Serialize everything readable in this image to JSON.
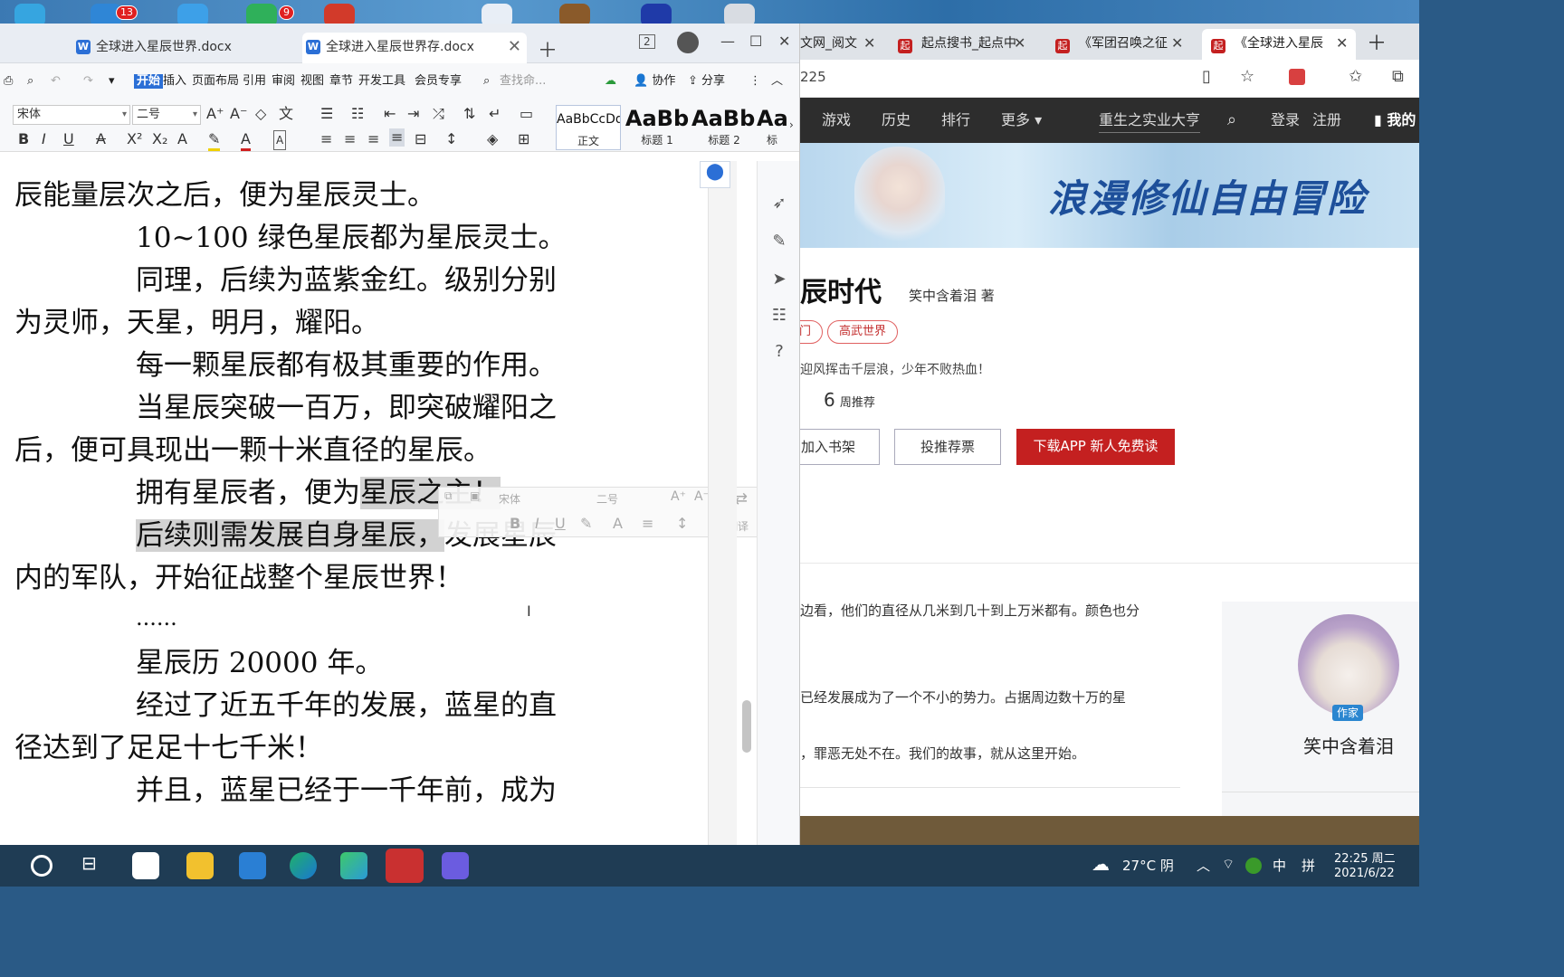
{
  "desktop": {
    "badges": [
      "13",
      "9"
    ]
  },
  "wps": {
    "tabs": [
      {
        "label": "全球进入星辰世界.docx"
      },
      {
        "label": "全球进入星辰世界存.docx"
      }
    ],
    "tab_count": "2",
    "menu": [
      "开始",
      "插入",
      "页面布局",
      "引用",
      "审阅",
      "视图",
      "章节",
      "开发工具",
      "会员专享"
    ],
    "search_placeholder": "查找命...",
    "collab": "协作",
    "share": "分享",
    "font": "宋体",
    "size": "二号",
    "styles": [
      {
        "preview": "AaBbCcDd",
        "label": "正文"
      },
      {
        "preview": "AaBb",
        "label": "标题 1"
      },
      {
        "preview": "AaBb(",
        "label": "标题 2"
      },
      {
        "preview": "AaI",
        "label": "标"
      }
    ],
    "doc_lines": [
      "辰能量层次之后，便为星辰灵士。",
      "10~100 绿色星辰都为星辰灵士。",
      "同理，后续为蓝紫金红。级别分别",
      "为灵师，天星，明月，耀阳。",
      "每一颗星辰都有极其重要的作用。",
      "当星辰突破一百万，即突破耀阳之",
      "后，便可具现出一颗十米直径的星辰。",
      "拥有星辰者，便为",
      "星辰之主！",
      "后续则需发展自身星辰，",
      "发展星辰",
      "内的军队，开始征战整个星辰世界！",
      "......",
      "星辰历 20000 年。",
      "经过了近五千年的发展，蓝星的直",
      "径达到了足足十七千米！",
      "并且，蓝星已经于一千年前，成为"
    ],
    "mini_toolbar": {
      "font": "宋体",
      "size": "二号",
      "translate": "翻译"
    }
  },
  "browser": {
    "tabs": [
      {
        "label": "文网_阅文"
      },
      {
        "label": "起点搜书_起点中"
      },
      {
        "label": "《军团召唤之征"
      },
      {
        "label": "《全球进入星辰"
      }
    ],
    "address": "225",
    "nav": [
      "游戏",
      "历史",
      "排行",
      "更多"
    ],
    "nav_search": "重生之实业大亨",
    "login": "登录",
    "register": "注册",
    "my_shelf": "我的",
    "banner_text": "浪漫修仙自由冒险",
    "book": {
      "title": "辰时代",
      "author": "笑中含着泪 著",
      "tags": [
        "门",
        "高武世界"
      ],
      "slogan": "迎风挥击千层浪，少年不败热血！",
      "week_rec_num": "6",
      "week_rec_label": "周推荐",
      "btn_shelf": "加入书架",
      "btn_vote": "投推荐票",
      "btn_app": "下载APP  新人免费读"
    },
    "intro": [
      "边看，他们的直径从几米到几十到上万米都有。颜色也分",
      "已经发展成为了一个不小的势力。占据周边数十万的星",
      "，罪恶无处不在。我们的故事，就从这里开始。"
    ],
    "author_badge": "作家",
    "author_name": "笑中含着泪"
  },
  "taskbar": {
    "weather": "27°C 阴",
    "ime1": "中",
    "ime2": "拼",
    "time": "22:25 周二",
    "date": "2021/6/22"
  },
  "colors": {
    "wps_accent": "#2b6fd6",
    "qidian_red": "#c42020",
    "highlight": "#d2d2d2"
  }
}
